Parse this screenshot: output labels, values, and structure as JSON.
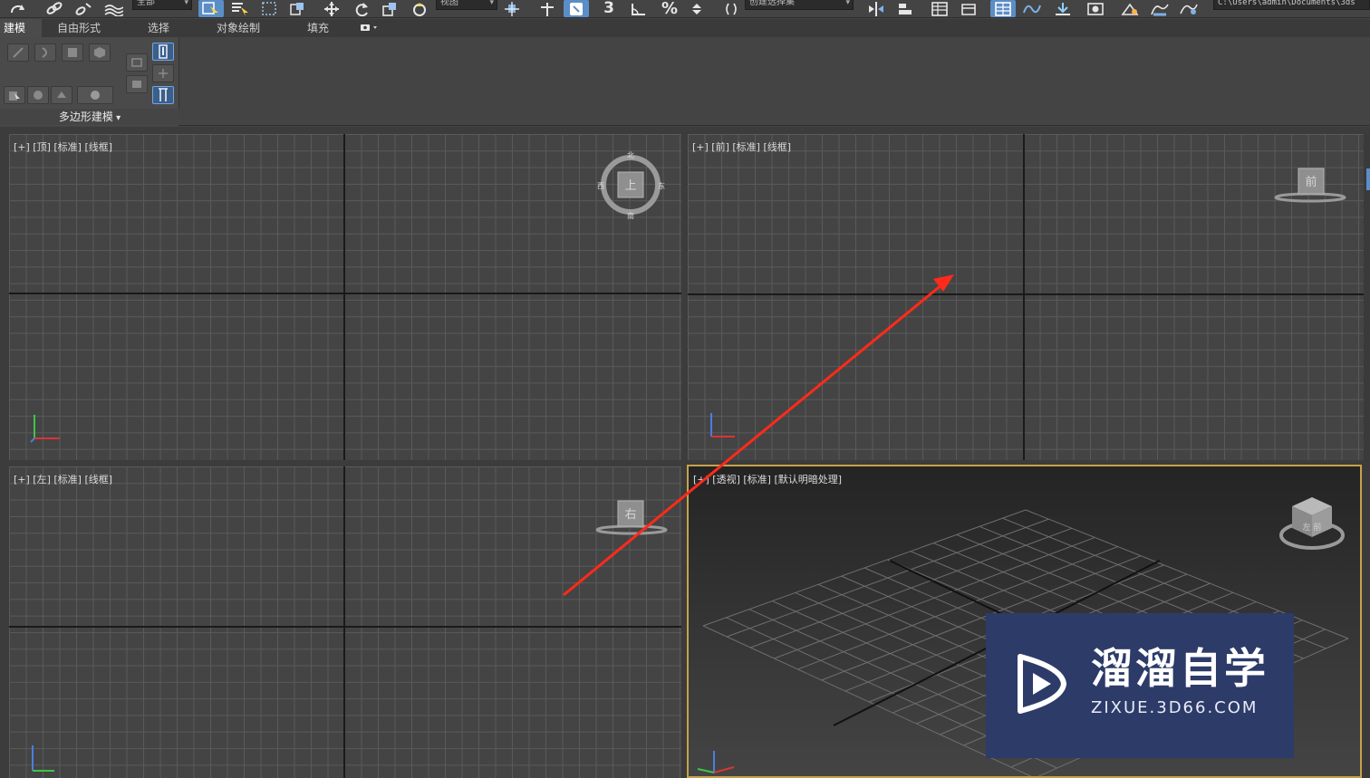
{
  "toolbar": {
    "selection_filter": "全部",
    "reference_coord": "视图",
    "named_selection": "创建选择集",
    "spinner_value": "3",
    "path": "C:\\Users\\admin\\Documents\\3ds"
  },
  "ribbon": {
    "tabs": [
      {
        "label": "建模",
        "active": true
      },
      {
        "label": "自由形式"
      },
      {
        "label": "选择"
      },
      {
        "label": "对象绘制"
      },
      {
        "label": "填充"
      }
    ],
    "group_label": "多边形建模"
  },
  "viewports": [
    {
      "id": "top",
      "label": "[+] [顶] [标准] [线框]",
      "navcube_face": "上",
      "compass": [
        "北",
        "东",
        "南",
        "西"
      ]
    },
    {
      "id": "front",
      "label": "[+] [前] [标准] [线框]",
      "navcube_face": "前"
    },
    {
      "id": "left",
      "label": "[+] [左] [标准] [线框]",
      "navcube_face": "右"
    },
    {
      "id": "perspective",
      "label": "[+] [透视] [标准] [默认明暗处理]",
      "navcube_face": "左 前",
      "active": true
    }
  ],
  "watermark": {
    "name": "溜溜自学",
    "url": "ZIXUE.3D66.COM",
    "color": "#2d3b69"
  },
  "annotation": {
    "color": "#ff2a1a"
  }
}
